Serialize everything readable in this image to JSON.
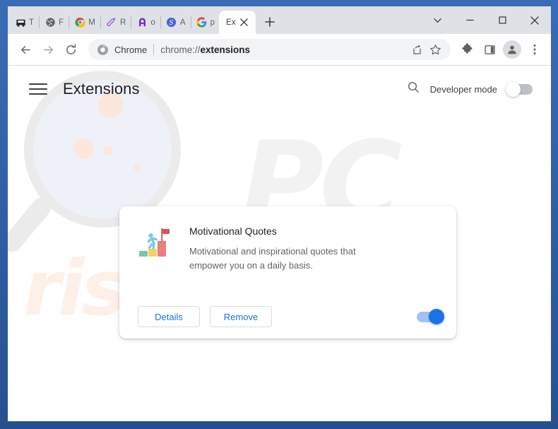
{
  "window": {
    "controls": {
      "tab_search": "tab-search-chevron",
      "minimize": "minimize",
      "maximize": "maximize",
      "close": "close"
    }
  },
  "tabs": [
    {
      "title": "T",
      "favicon": "truck-icon"
    },
    {
      "title": "F",
      "favicon": "globe-icon"
    },
    {
      "title": "M",
      "favicon": "chrome-icon"
    },
    {
      "title": "R",
      "favicon": "comet-icon"
    },
    {
      "title": "o",
      "favicon": "letter-a-purple-icon"
    },
    {
      "title": "A",
      "favicon": "letter-s-blue-icon"
    },
    {
      "title": "p",
      "favicon": "google-g-icon"
    },
    {
      "title": "Ex",
      "favicon": "none",
      "active": true
    }
  ],
  "new_tab_label": "+",
  "toolbar": {
    "back": "back-arrow",
    "forward": "forward-arrow",
    "reload": "reload",
    "omnibox": {
      "scheme_label": "Chrome",
      "url_prefix": "chrome://",
      "url_bold": "extensions",
      "share_icon": "share-icon",
      "bookmark_icon": "star-icon"
    },
    "extensions_icon": "puzzle-icon",
    "side_panel_icon": "side-panel-icon",
    "profile_icon": "person-icon",
    "menu_icon": "three-dot-menu-icon"
  },
  "page": {
    "title": "Extensions",
    "menu_icon": "hamburger-menu-icon",
    "search_icon": "search-icon",
    "developer_mode_label": "Developer mode",
    "developer_mode_on": false
  },
  "extension": {
    "name": "Motivational Quotes",
    "description": "Motivational and inspirational quotes that empower you on a daily basis.",
    "icon": "person-climbing-steps-with-flag-icon",
    "details_label": "Details",
    "remove_label": "Remove",
    "enabled": true
  },
  "watermark": {
    "brand_mark": "PC",
    "domain": "risk.com"
  },
  "colors": {
    "window_frame": "#2f5da3",
    "tab_strip": "#dee1e6",
    "accent_blue": "#1a73e8",
    "omnibox_bg": "#f1f3f4",
    "toggle_off": "#bdc1c6"
  }
}
